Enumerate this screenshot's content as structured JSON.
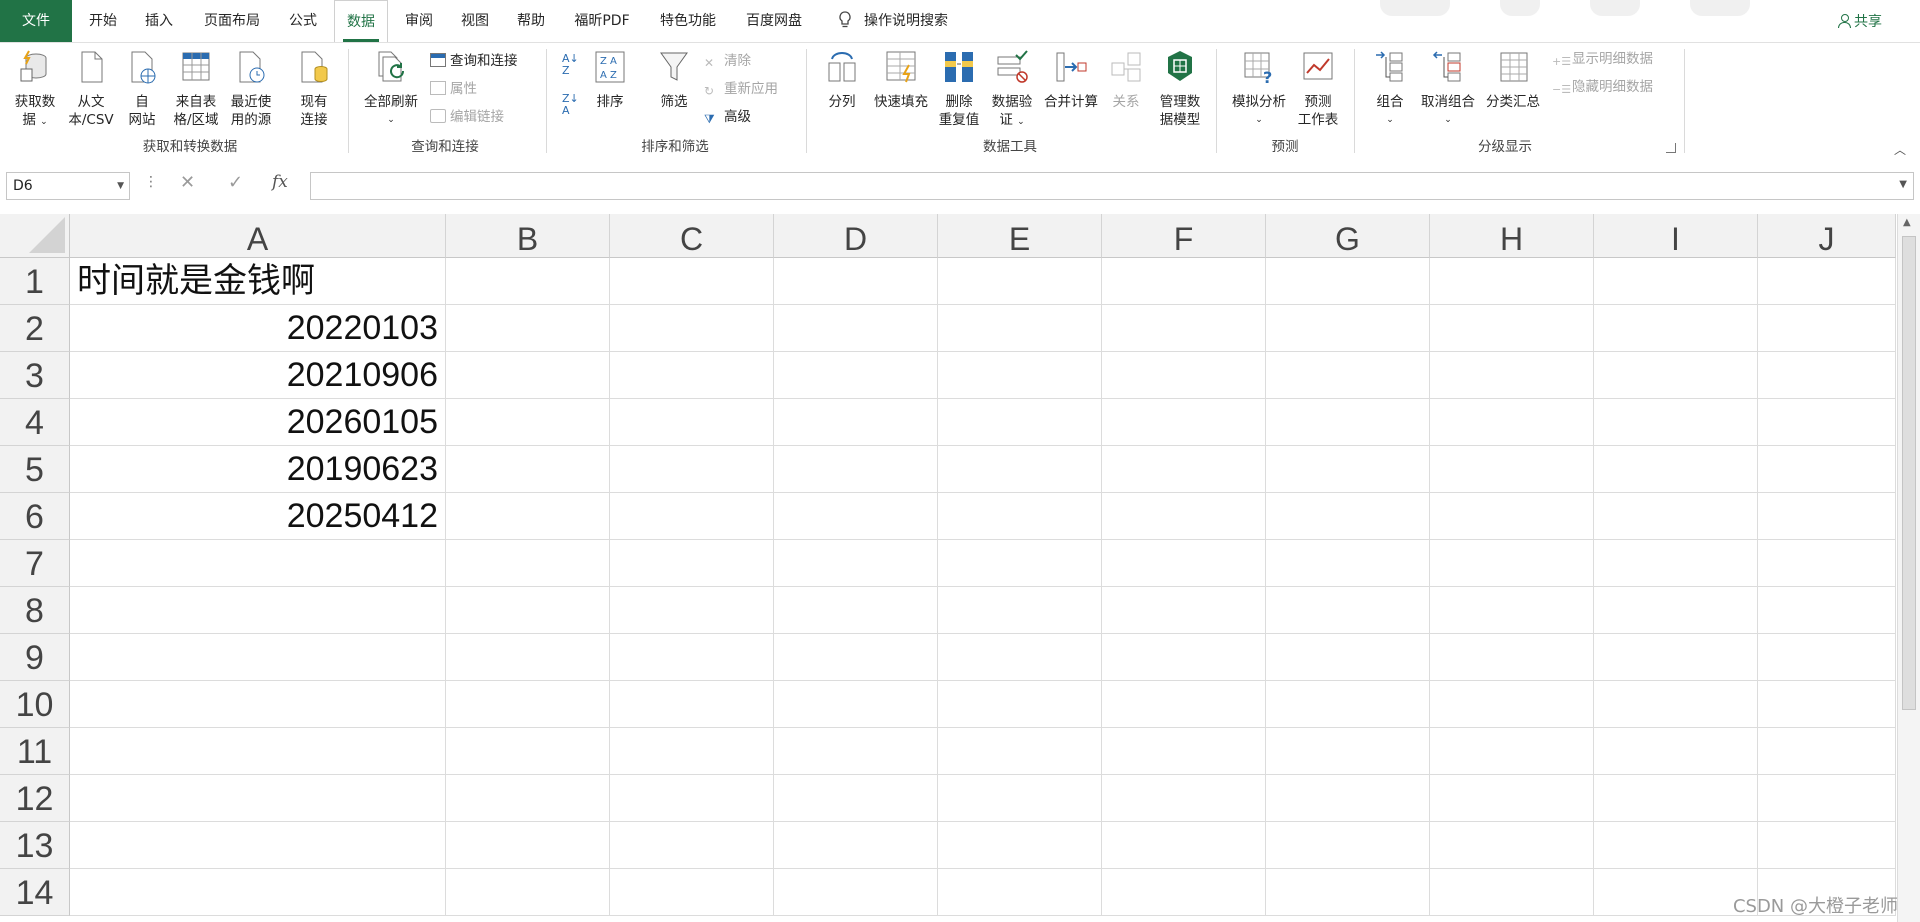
{
  "tabs": [
    "文件",
    "开始",
    "插入",
    "页面布局",
    "公式",
    "数据",
    "审阅",
    "视图",
    "帮助",
    "福昕PDF",
    "特色功能",
    "百度网盘"
  ],
  "active_tab": "数据",
  "tell_me": "操作说明搜索",
  "share": "共享",
  "ribbon": {
    "get_data_1": "获取数",
    "get_data_2": "据",
    "from_text_1": "从文",
    "from_text_2": "本/CSV",
    "from_web_1": "自",
    "from_web_2": "网站",
    "from_table_1": "来自表",
    "from_table_2": "格/区域",
    "recent_1": "最近使",
    "recent_2": "用的源",
    "existing_1": "现有",
    "existing_2": "连接",
    "group_get": "获取和转换数据",
    "refresh_all": "全部刷新",
    "queries_connections": "查询和连接",
    "properties": "属性",
    "edit_links": "编辑链接",
    "group_queries": "查询和连接",
    "sort": "排序",
    "filter": "筛选",
    "clear": "清除",
    "reapply": "重新应用",
    "advanced": "高级",
    "group_sort": "排序和筛选",
    "text_to_columns": "分列",
    "flash_fill": "快速填充",
    "remove_dup_1": "删除",
    "remove_dup_2": "重复值",
    "validation_1": "数据验",
    "validation_2": "证",
    "consolidate": "合并计算",
    "relationships": "关系",
    "data_model_1": "管理数",
    "data_model_2": "据模型",
    "group_tools": "数据工具",
    "whatif": "模拟分析",
    "forecast_1": "预测",
    "forecast_2": "工作表",
    "group_forecast": "预测",
    "group_btn": "组合",
    "ungroup": "取消组合",
    "subtotal": "分类汇总",
    "show_detail": "显示明细数据",
    "hide_detail": "隐藏明细数据",
    "group_outline": "分级显示"
  },
  "formula_bar": {
    "name_box": "D6",
    "value": ""
  },
  "columns": [
    "A",
    "B",
    "C",
    "D",
    "E",
    "F",
    "G",
    "H",
    "I",
    "J"
  ],
  "rows": [
    "1",
    "2",
    "3",
    "4",
    "5",
    "6",
    "7",
    "8",
    "9",
    "10",
    "11",
    "12",
    "13",
    "14"
  ],
  "cells": {
    "A1": "时间就是金钱啊",
    "A2": "20220103",
    "A3": "20210906",
    "A4": "20260105",
    "A5": "20190623",
    "A6": "20250412"
  },
  "watermark": "CSDN @大橙子老师"
}
